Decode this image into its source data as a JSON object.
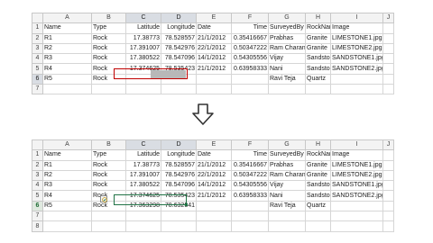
{
  "columns": [
    "A",
    "B",
    "C",
    "D",
    "E",
    "F",
    "G",
    "H",
    "I",
    "J"
  ],
  "header_row": [
    "Name",
    "Type",
    "Latitude",
    "Longitude",
    "Date",
    "Time",
    "SurveyedBy",
    "RockName",
    "Image",
    ""
  ],
  "top_rows": [
    {
      "num": "1",
      "cells": [
        "Name",
        "Type",
        "Latitude",
        "Longitude",
        "Date",
        "Time",
        "SurveyedBy",
        "RockName",
        "Image",
        ""
      ]
    },
    {
      "num": "2",
      "cells": [
        "R1",
        "Rock",
        "17.38773",
        "78.528557",
        "21/1/2012",
        "0.35416667",
        "Prabhas",
        "Granite",
        "LIMESTONE1.jpg",
        ""
      ]
    },
    {
      "num": "3",
      "cells": [
        "R2",
        "Rock",
        "17.391007",
        "78.542976",
        "22/1/2012",
        "0.50347222",
        "Ram Charan",
        "Granite",
        "LIMESTONE2.jpg",
        ""
      ]
    },
    {
      "num": "4",
      "cells": [
        "R3",
        "Rock",
        "17.380522",
        "78.547096",
        "14/1/2012",
        "0.54305556",
        "Vijay",
        "Sandstone",
        "SANDSTONE1.jpg",
        ""
      ]
    },
    {
      "num": "5",
      "cells": [
        "R4",
        "Rock",
        "17.374625",
        "78.535423",
        "21/1/2012",
        "0.63958333",
        "Nani",
        "Sandstone",
        "SANDSTONE2.jpg",
        ""
      ]
    },
    {
      "num": "6",
      "cells": [
        "R5",
        "Rock",
        "",
        "",
        "",
        "",
        "Ravi Teja",
        "Quartz",
        "",
        ""
      ]
    },
    {
      "num": "7",
      "cells": [
        "",
        "",
        "",
        "",
        "",
        "",
        "",
        "",
        "",
        ""
      ]
    }
  ],
  "bottom_rows": [
    {
      "num": "1",
      "cells": [
        "Name",
        "Type",
        "Latitude",
        "Longitude",
        "Date",
        "Time",
        "SurveyedBy",
        "RockName",
        "Image",
        ""
      ]
    },
    {
      "num": "2",
      "cells": [
        "R1",
        "Rock",
        "17.38773",
        "78.528557",
        "21/1/2012",
        "0.35416667",
        "Prabhas",
        "Granite",
        "LIMESTONE1.jpg",
        ""
      ]
    },
    {
      "num": "3",
      "cells": [
        "R2",
        "Rock",
        "17.391007",
        "78.542976",
        "22/1/2012",
        "0.50347222",
        "Ram Charan",
        "Granite",
        "LIMESTONE2.jpg",
        ""
      ]
    },
    {
      "num": "4",
      "cells": [
        "R3",
        "Rock",
        "17.380522",
        "78.547096",
        "14/1/2012",
        "0.54305556",
        "Vijay",
        "Sandstone",
        "SANDSTONE1.jpg",
        ""
      ]
    },
    {
      "num": "5",
      "cells": [
        "R4",
        "Rock",
        "17.374625",
        "78.535423",
        "21/1/2012",
        "0.63958333",
        "Nani",
        "Sandstone",
        "SANDSTONE2.jpg",
        ""
      ]
    },
    {
      "num": "6",
      "cells": [
        "R5",
        "Rock",
        "17.363298",
        "78.632541",
        "",
        "",
        "Ravi Teja",
        "Quartz",
        "",
        ""
      ]
    },
    {
      "num": "7",
      "cells": [
        "",
        "",
        "",
        "",
        "",
        "",
        "",
        "",
        "",
        ""
      ]
    },
    {
      "num": "8",
      "cells": [
        "",
        "",
        "",
        "",
        "",
        "",
        "",
        "",
        "",
        ""
      ]
    }
  ],
  "arrow_icon": "down-arrow-icon",
  "autofill_icon": "autofill-options-icon",
  "colors": {
    "highlight_red": "#c00000",
    "selection_green": "#217346",
    "header_bg": "#f3f3f3",
    "gridline": "#d6d6d6"
  }
}
